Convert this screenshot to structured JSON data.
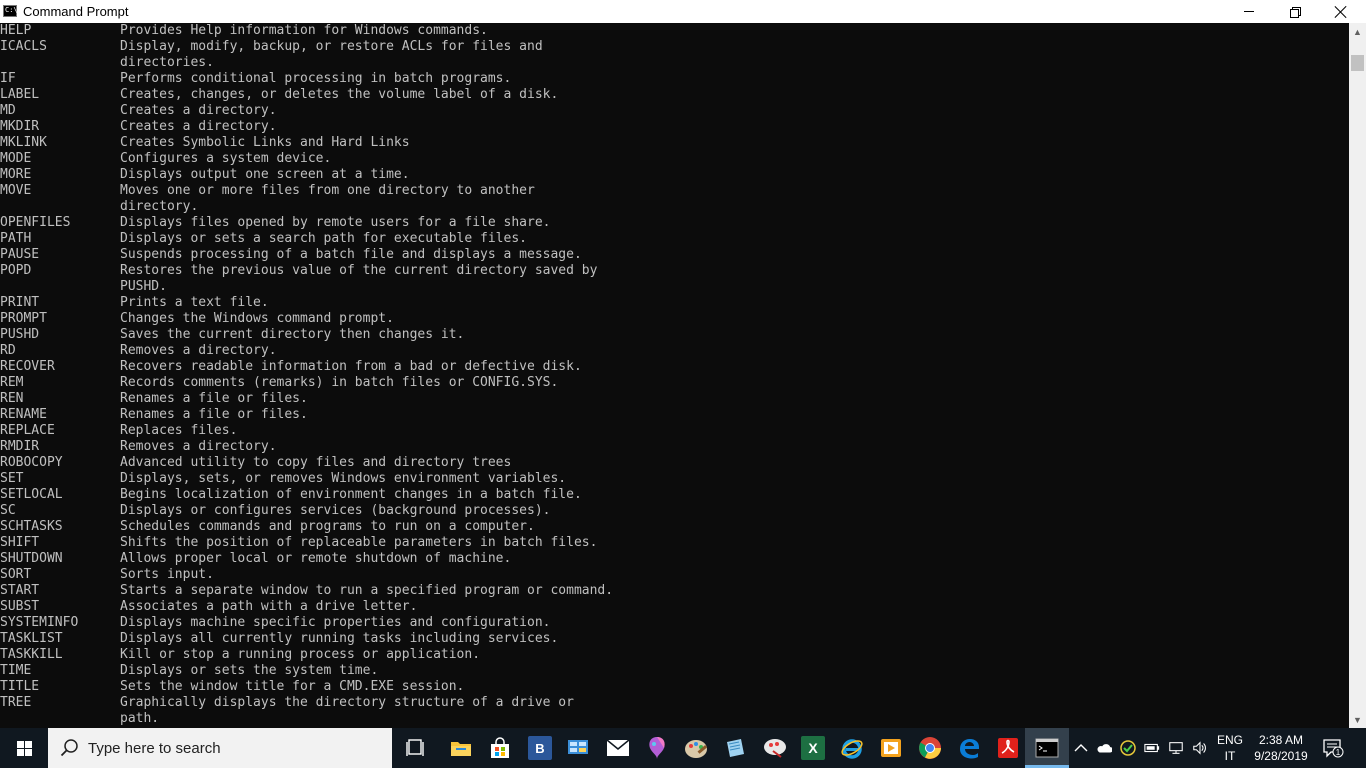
{
  "window": {
    "title": "Command Prompt",
    "icon_glyph": "C:\\"
  },
  "console": {
    "lines": [
      {
        "cmd": "HELP",
        "desc": "Provides Help information for Windows commands."
      },
      {
        "cmd": "ICACLS",
        "desc": "Display, modify, backup, or restore ACLs for files and"
      },
      {
        "cmd": "",
        "desc": "directories."
      },
      {
        "cmd": "IF",
        "desc": "Performs conditional processing in batch programs."
      },
      {
        "cmd": "LABEL",
        "desc": "Creates, changes, or deletes the volume label of a disk."
      },
      {
        "cmd": "MD",
        "desc": "Creates a directory."
      },
      {
        "cmd": "MKDIR",
        "desc": "Creates a directory."
      },
      {
        "cmd": "MKLINK",
        "desc": "Creates Symbolic Links and Hard Links"
      },
      {
        "cmd": "MODE",
        "desc": "Configures a system device."
      },
      {
        "cmd": "MORE",
        "desc": "Displays output one screen at a time."
      },
      {
        "cmd": "MOVE",
        "desc": "Moves one or more files from one directory to another"
      },
      {
        "cmd": "",
        "desc": "directory."
      },
      {
        "cmd": "OPENFILES",
        "desc": "Displays files opened by remote users for a file share."
      },
      {
        "cmd": "PATH",
        "desc": "Displays or sets a search path for executable files."
      },
      {
        "cmd": "PAUSE",
        "desc": "Suspends processing of a batch file and displays a message."
      },
      {
        "cmd": "POPD",
        "desc": "Restores the previous value of the current directory saved by"
      },
      {
        "cmd": "",
        "desc": "PUSHD."
      },
      {
        "cmd": "PRINT",
        "desc": "Prints a text file."
      },
      {
        "cmd": "PROMPT",
        "desc": "Changes the Windows command prompt."
      },
      {
        "cmd": "PUSHD",
        "desc": "Saves the current directory then changes it."
      },
      {
        "cmd": "RD",
        "desc": "Removes a directory."
      },
      {
        "cmd": "RECOVER",
        "desc": "Recovers readable information from a bad or defective disk."
      },
      {
        "cmd": "REM",
        "desc": "Records comments (remarks) in batch files or CONFIG.SYS."
      },
      {
        "cmd": "REN",
        "desc": "Renames a file or files."
      },
      {
        "cmd": "RENAME",
        "desc": "Renames a file or files."
      },
      {
        "cmd": "REPLACE",
        "desc": "Replaces files."
      },
      {
        "cmd": "RMDIR",
        "desc": "Removes a directory."
      },
      {
        "cmd": "ROBOCOPY",
        "desc": "Advanced utility to copy files and directory trees"
      },
      {
        "cmd": "SET",
        "desc": "Displays, sets, or removes Windows environment variables."
      },
      {
        "cmd": "SETLOCAL",
        "desc": "Begins localization of environment changes in a batch file."
      },
      {
        "cmd": "SC",
        "desc": "Displays or configures services (background processes)."
      },
      {
        "cmd": "SCHTASKS",
        "desc": "Schedules commands and programs to run on a computer."
      },
      {
        "cmd": "SHIFT",
        "desc": "Shifts the position of replaceable parameters in batch files."
      },
      {
        "cmd": "SHUTDOWN",
        "desc": "Allows proper local or remote shutdown of machine."
      },
      {
        "cmd": "SORT",
        "desc": "Sorts input."
      },
      {
        "cmd": "START",
        "desc": "Starts a separate window to run a specified program or command."
      },
      {
        "cmd": "SUBST",
        "desc": "Associates a path with a drive letter."
      },
      {
        "cmd": "SYSTEMINFO",
        "desc": "Displays machine specific properties and configuration."
      },
      {
        "cmd": "TASKLIST",
        "desc": "Displays all currently running tasks including services."
      },
      {
        "cmd": "TASKKILL",
        "desc": "Kill or stop a running process or application."
      },
      {
        "cmd": "TIME",
        "desc": "Displays or sets the system time."
      },
      {
        "cmd": "TITLE",
        "desc": "Sets the window title for a CMD.EXE session."
      },
      {
        "cmd": "TREE",
        "desc": "Graphically displays the directory structure of a drive or"
      },
      {
        "cmd": "",
        "desc": "path."
      }
    ],
    "text_color": "#c0c0c0",
    "background": "#0c0c0c"
  },
  "taskbar": {
    "search_placeholder": "Type here to search",
    "pinned_icons": [
      "task-view-icon",
      "file-explorer-icon",
      "store-icon",
      "bing-icon",
      "control-panel-icon",
      "mail-icon",
      "paint-3d-icon",
      "paint-icon",
      "notes-icon",
      "snipping-icon",
      "excel-icon",
      "internet-explorer-icon",
      "media-player-icon",
      "chrome-icon",
      "edge-icon",
      "acrobat-icon",
      "command-prompt-icon"
    ],
    "tray": {
      "language_primary": "ENG",
      "language_secondary": "IT",
      "time": "2:38 AM",
      "date": "9/28/2019",
      "notification_count": "1"
    }
  },
  "colors": {
    "taskbar": "#101820",
    "accent": "#76b9ed",
    "excel": "#1d6f42",
    "chrome_red": "#db4437",
    "edge_blue": "#0a7cd6",
    "acrobat_red": "#e0211b"
  }
}
